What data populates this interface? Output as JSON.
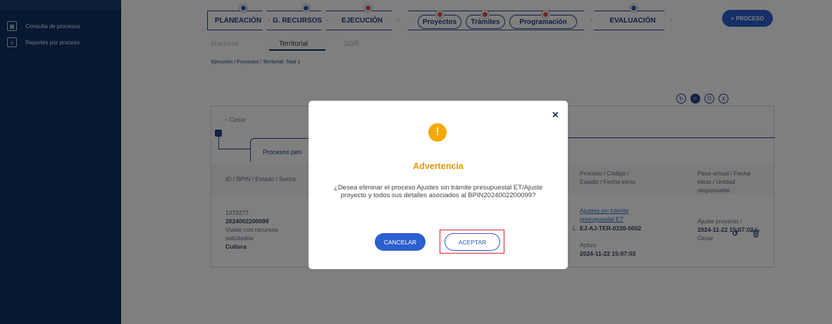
{
  "sidebar": {
    "items": [
      {
        "label": "Consulta de procesos",
        "icon": "table-icon"
      },
      {
        "label": "Reportes por proceso",
        "icon": "report-icon"
      }
    ]
  },
  "process_steps": {
    "planeacion": "PLANEACIÓN",
    "gestion_recursos": "G. RECURSOS",
    "ejecucion": "EJECUCIÓN",
    "proyectos": "Proyectos",
    "tramites": "Trámites",
    "programacion": "Programación",
    "evaluacion": "EVALUACIÓN"
  },
  "add_process_label": "+ PROCESO",
  "tabs": [
    "Nacional",
    "Territorial",
    "SGR"
  ],
  "breadcrumb": "Ejecución / Proyectos / Territorial. Total 1",
  "filter_label": "- Cesar",
  "processes_tab_label": "Procesos pen",
  "table": {
    "headers": {
      "col1": "ID / BPIN / Estado / Sector",
      "col_proceso": "Proceso / Código / Estado / Fecha inicio",
      "col_paso": "Paso actual / Fecha inicio / Unidad responsable"
    },
    "row": {
      "id": "1073277",
      "bpin": "2024002200099",
      "estado": "Viable con recursos solicitados",
      "sector": "Cultura",
      "proceso_link": "Ajustes sin trámite presupuestal ET",
      "codigo": "EJ-AJ-TER-0220-0002",
      "proceso_estado": "Activo",
      "proceso_fecha": "2024-11-22 15:07:03",
      "paso_actual": "Ajuste proyecto /",
      "paso_fecha": "2024-11-22 15:07:02 /",
      "unidad": "Cesar",
      "l_marker": "L"
    }
  },
  "modal": {
    "close_symbol": "×",
    "icon_symbol": "!",
    "title": "Advertencia",
    "message": "¿Desea eliminar el proceso Ajustes sin trámite presupuestal ET/Ajuste proyecto y todos sus detalles asociados al BPIN2024002200099?",
    "cancel_label": "CANCELAR",
    "accept_label": "ACEPTAR"
  },
  "colors": {
    "sidebar": "#0e3063",
    "accent": "#2c5fcf",
    "warning": "#f5a800",
    "highlight": "#d9232d"
  }
}
